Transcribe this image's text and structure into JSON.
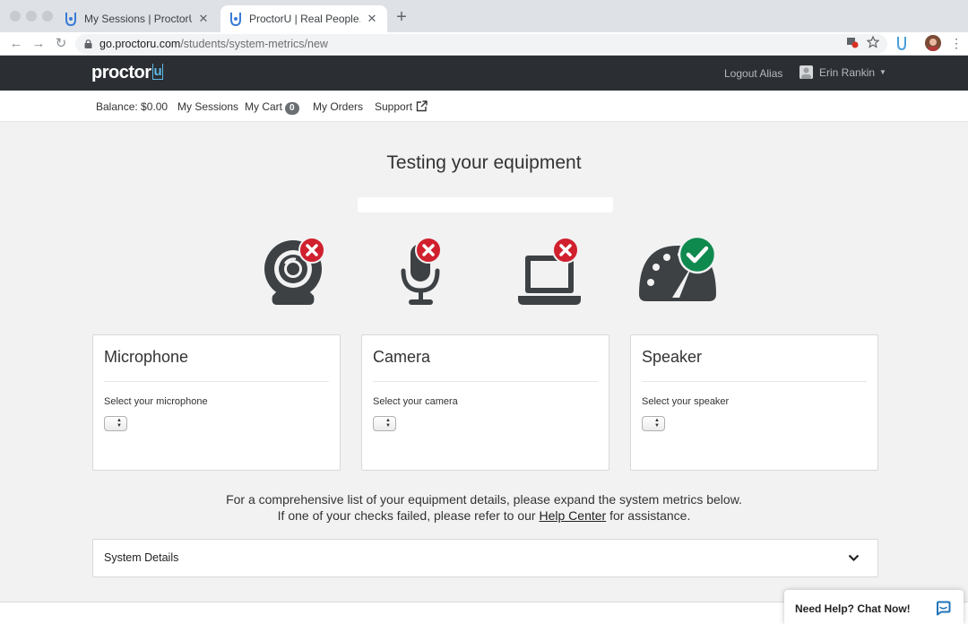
{
  "browser": {
    "tabs": [
      {
        "title": "My Sessions | ProctorU",
        "active": false
      },
      {
        "title": "ProctorU | Real People. Real Proctors.",
        "active": true
      }
    ],
    "url_host": "go.proctoru.com",
    "url_path": "/students/system-metrics/new"
  },
  "header": {
    "logo": "proctor",
    "logo_u": "u",
    "logout": "Logout Alias",
    "user_name": "Erin Rankin"
  },
  "subnav": {
    "balance": "Balance: $0.00",
    "sessions": "My Sessions",
    "cart": "My Cart",
    "cart_count": "0",
    "orders": "My Orders",
    "support": "Support"
  },
  "main": {
    "title": "Testing your equipment",
    "checks": [
      {
        "name": "webcam",
        "status": "fail"
      },
      {
        "name": "microphone",
        "status": "fail"
      },
      {
        "name": "computer",
        "status": "fail"
      },
      {
        "name": "speed",
        "status": "pass"
      }
    ],
    "cards": [
      {
        "title": "Microphone",
        "label": "Select your microphone"
      },
      {
        "title": "Camera",
        "label": "Select your camera"
      },
      {
        "title": "Speaker",
        "label": "Select your speaker"
      }
    ],
    "info_line1": "For a comprehensive list of your equipment details, please expand the system metrics below.",
    "info_line2_pre": "If one of your checks failed, please refer to our ",
    "info_link": "Help Center",
    "info_line2_post": " for assistance.",
    "details_title": "System Details"
  },
  "chat": {
    "label": "Need Help? Chat Now!"
  },
  "colors": {
    "header_bg": "#2b2f33",
    "fail": "#d0202e",
    "pass": "#0f8a4f",
    "icon": "#3d4144"
  }
}
